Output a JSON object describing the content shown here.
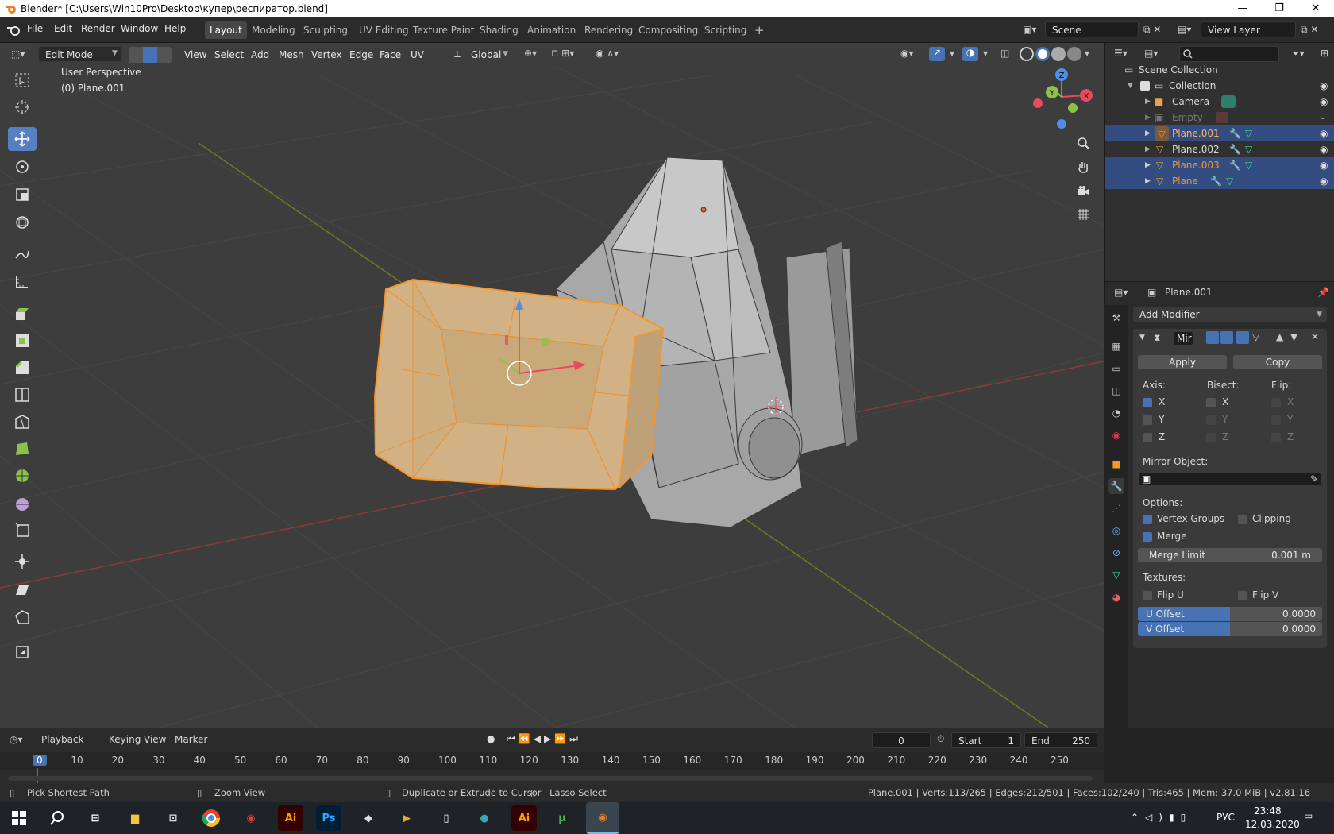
{
  "window": {
    "title": "Blender* [C:\\Users\\Win10Pro\\Desktop\\купер\\респиратор.blend]"
  },
  "menu": [
    "File",
    "Edit",
    "Render",
    "Window",
    "Help"
  ],
  "workspaces": [
    "Layout",
    "Modeling",
    "Sculpting",
    "UV Editing",
    "Texture Paint",
    "Shading",
    "Animation",
    "Rendering",
    "Compositing",
    "Scripting"
  ],
  "scene": {
    "name": "Scene",
    "view_layer": "View Layer"
  },
  "viewport": {
    "mode": "Edit Mode",
    "menus": [
      "View",
      "Select",
      "Add",
      "Mesh",
      "Vertex",
      "Edge",
      "Face",
      "UV"
    ],
    "transform": "Global",
    "overlay_line1": "User Perspective",
    "overlay_line2": "(0) Plane.001",
    "gizmo_axes": {
      "x": "X",
      "y": "Y",
      "z": "Z"
    },
    "colors": {
      "x": "#e84a5f",
      "y": "#8bc34a",
      "z": "#4a8fe8",
      "selection": "#f5962a"
    }
  },
  "outliner": {
    "root": "Scene Collection",
    "collection": "Collection",
    "items": [
      {
        "name": "Camera",
        "selected": false,
        "active": false
      },
      {
        "name": "Empty",
        "selected": false,
        "active": false
      },
      {
        "name": "Plane.001",
        "selected": true,
        "active": true
      },
      {
        "name": "Plane.002",
        "selected": false,
        "active": false
      },
      {
        "name": "Plane.003",
        "selected": true,
        "active": false
      },
      {
        "name": "Plane",
        "selected": true,
        "active": false
      }
    ]
  },
  "properties": {
    "object": "Plane.001",
    "add_modifier": "Add Modifier",
    "modifier_name": "Mir",
    "apply": "Apply",
    "copy": "Copy",
    "axis_label": "Axis:",
    "bisect_label": "Bisect:",
    "flip_label": "Flip:",
    "axis": [
      {
        "label": "X",
        "on": true
      },
      {
        "label": "Y",
        "on": false
      },
      {
        "label": "Z",
        "on": false
      }
    ],
    "bisect": [
      "X",
      "Y",
      "Z"
    ],
    "flip": [
      "X",
      "Y",
      "Z"
    ],
    "mirror_object_label": "Mirror Object:",
    "options_label": "Options:",
    "vertex_groups": "Vertex Groups",
    "clipping": "Clipping",
    "merge": "Merge",
    "merge_limit_label": "Merge Limit",
    "merge_limit_value": "0.001 m",
    "textures_label": "Textures:",
    "flip_u": "Flip U",
    "flip_v": "Flip V",
    "u_offset_label": "U Offset",
    "u_offset_value": "0.0000",
    "v_offset_label": "V Offset",
    "v_offset_value": "0.0000"
  },
  "timeline": {
    "menus": [
      "Playback",
      "Keying",
      "View",
      "Marker"
    ],
    "current_frame": "0",
    "start_label": "Start",
    "start": "1",
    "end_label": "End",
    "end": "250",
    "ruler": [
      "0",
      "10",
      "20",
      "30",
      "40",
      "50",
      "60",
      "70",
      "80",
      "90",
      "100",
      "110",
      "120",
      "130",
      "140",
      "150",
      "160",
      "170",
      "180",
      "190",
      "200",
      "210",
      "220",
      "230",
      "240",
      "250"
    ]
  },
  "status": {
    "hints": [
      "Pick Shortest Path",
      "Zoom View",
      "Duplicate or Extrude to Cursor",
      "Lasso Select"
    ],
    "stats": "Plane.001 | Verts:113/265 | Edges:212/501 | Faces:102/240 | Tris:465 | Mem: 37.0 MiB | v2.81.16"
  },
  "taskbar": {
    "language": "РУС",
    "time": "23:48",
    "date": "12.03.2020",
    "apps": [
      "Ai",
      "Ps",
      "Ai"
    ]
  }
}
